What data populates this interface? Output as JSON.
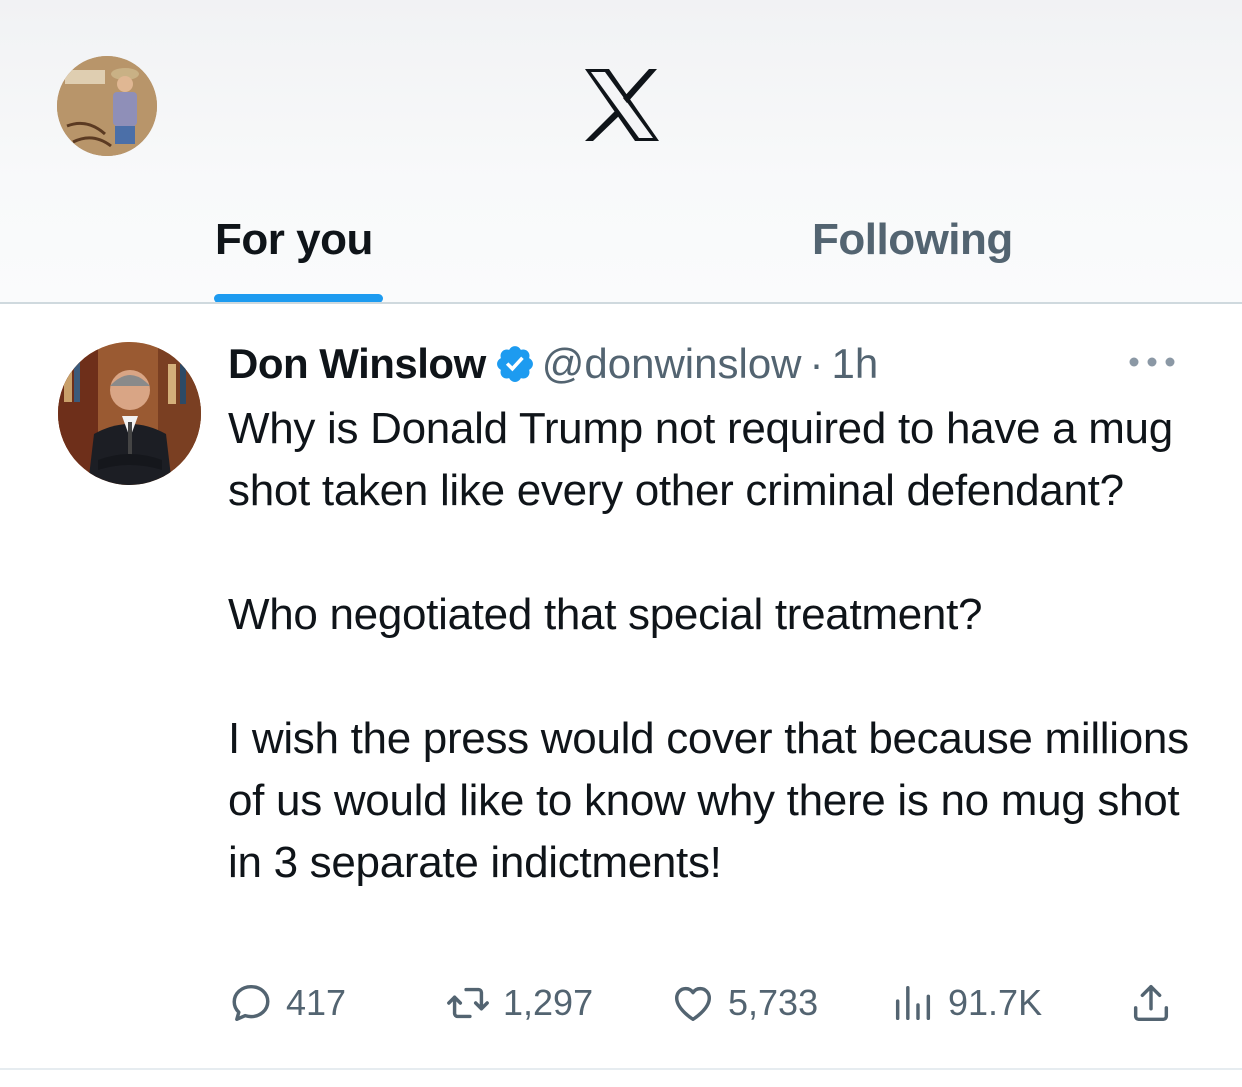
{
  "header": {
    "logo_icon": "x-logo-icon",
    "avatar_icon": "profile-avatar"
  },
  "tabs": [
    {
      "label": "For you",
      "active": true
    },
    {
      "label": "Following",
      "active": false
    }
  ],
  "tweet": {
    "author_name": "Don Winslow",
    "verified": true,
    "handle": "@donwinslow",
    "separator": "·",
    "time": "1h",
    "paragraphs": [
      "Why is Donald Trump not required to have a mug shot taken like every other criminal defendant?",
      "Who negotiated that special treatment?",
      "I wish the press would cover that because millions of us would like to know why there is no mug shot in 3 separate indictments!"
    ],
    "actions": {
      "replies": "417",
      "reposts": "1,297",
      "likes": "5,733",
      "views": "91.7K"
    }
  },
  "colors": {
    "accent": "#1d9bf0",
    "text_primary": "#0f1419",
    "text_secondary": "#536471",
    "divider": "#cfd9de"
  }
}
